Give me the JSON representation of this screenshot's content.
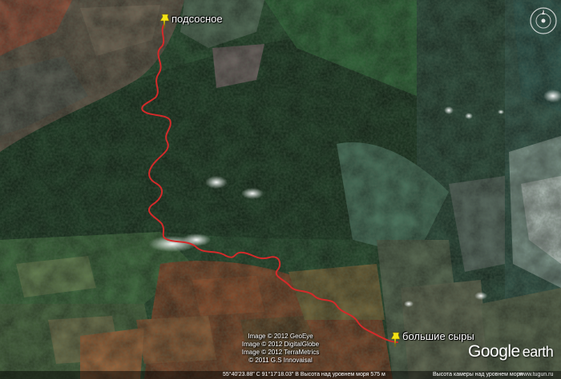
{
  "map": {
    "start_label": "подсосное",
    "end_label": "большие сыры",
    "route_color": "#d42a2a",
    "pin_color": "#f3e316"
  },
  "attribution": {
    "line1": "Image © 2012 GeoEye",
    "line2": "Image © 2012 DigitalGlobe",
    "line3": "Image © 2012 TerraMetrics",
    "line4": "© 2011 G.S Innovaisal"
  },
  "logo": {
    "google": "Google",
    "earth": "earth"
  },
  "status_bar": {
    "coords": "55°40'23.88\" С  91°17'18.03\" В  Высота над уровнем моря   575 м",
    "camera": "Высота камеры над уровнем моря",
    "watermark": "www.tugun.ru"
  },
  "icons": {
    "compass": "compass-icon",
    "pin": "pushpin-icon"
  }
}
